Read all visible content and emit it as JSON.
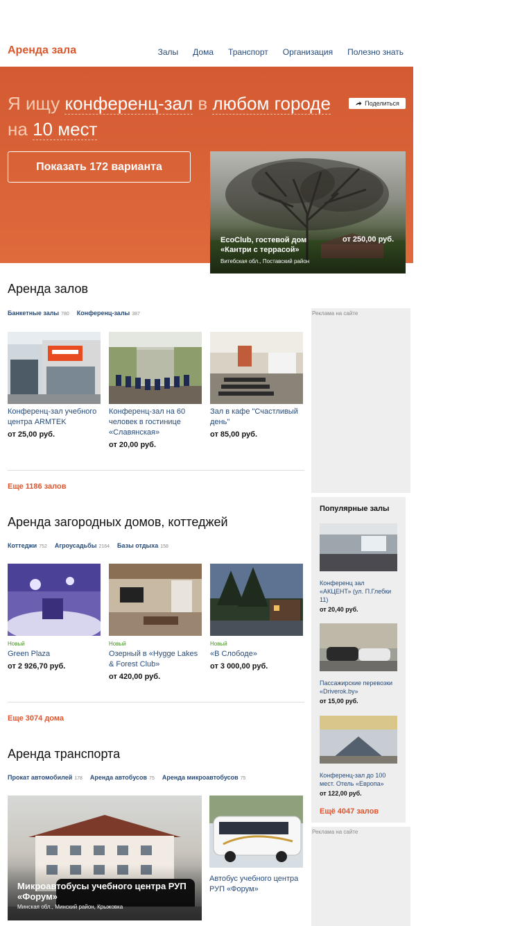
{
  "header": {
    "logo": "Аренда зала",
    "nav": [
      "Залы",
      "Дома",
      "Транспорт",
      "Организация",
      "Полезно знать"
    ]
  },
  "hero": {
    "line1_prefix": "Я ищу",
    "venue_type": "конференц-зал",
    "line1_mid": "в",
    "city": "любом городе",
    "line2_prefix": "на",
    "capacity": "10 мест",
    "share_label": "Поделиться",
    "show_button": "Показать 172 варианта",
    "featured": {
      "title": "EcoClub, гостевой дом «Кантри с террасой»",
      "price": "от 250,00 руб.",
      "location": "Витебская обл., Поставский район"
    }
  },
  "halls": {
    "title": "Аренда залов",
    "categories": [
      {
        "label": "Банкетные залы",
        "count": "780"
      },
      {
        "label": "Конференц-залы",
        "count": "387"
      }
    ],
    "cards": [
      {
        "title": "Конференц-зал учебного центра ARMTEK",
        "price": "от 25,00 руб."
      },
      {
        "title": "Конференц-зал на 60 человек в гостинице «Славянская»",
        "price": "от 20,00 руб."
      },
      {
        "title": "Зал в кафе \"Счастливый день\"",
        "price": "от 85,00 руб."
      }
    ],
    "more": "Еще 1186 залов"
  },
  "houses": {
    "title": "Аренда загородных домов, коттеджей",
    "categories": [
      {
        "label": "Коттеджи",
        "count": "752"
      },
      {
        "label": "Агроусадьбы",
        "count": "2164"
      },
      {
        "label": "Базы отдыха",
        "count": "158"
      }
    ],
    "cards": [
      {
        "badge": "Новый",
        "title": "Green Plaza",
        "price": "от 2 926,70 руб."
      },
      {
        "badge": "Новый",
        "title": "Озерный в «Hygge Lakes & Forest Club»",
        "price": "от 420,00 руб."
      },
      {
        "badge": "Новый",
        "title": "«В Слободе»",
        "price": "от 3 000,00 руб."
      }
    ],
    "more": "Еще 3074 дома"
  },
  "transport": {
    "title": "Аренда транспорта",
    "categories": [
      {
        "label": "Прокат автомобилей",
        "count": "178"
      },
      {
        "label": "Аренда автобусов",
        "count": "75"
      },
      {
        "label": "Аренда микроавтобусов",
        "count": "75"
      }
    ],
    "big_card": {
      "title": "Микроавтобусы учебного центра РУП «Форум»",
      "location": "Минская обл., Минский район, Крыжовка"
    },
    "bus_card": {
      "title": "Автобус учебного центра РУП «Форум»"
    }
  },
  "sidebar": {
    "ad_label": "Реклама на сайте",
    "popular_title": "Популярные залы",
    "popular": [
      {
        "title": "Конференц зал «АКЦЕНТ» (ул. П.Глебки 11)",
        "price": "от 20,40 руб."
      },
      {
        "title": "Пассажирские перевозки «Driverok.by»",
        "price": "от 15,00 руб."
      },
      {
        "title": "Конференц-зал до 100 мест. Отель «Европа»",
        "price": "от 122,00 руб."
      }
    ],
    "popular_more": "Ещё 4047 залов"
  },
  "colors": {
    "accent": "#d9572b",
    "link": "#274a78",
    "hero_bg": "#d45a32",
    "new_badge": "#4a8a2a"
  }
}
